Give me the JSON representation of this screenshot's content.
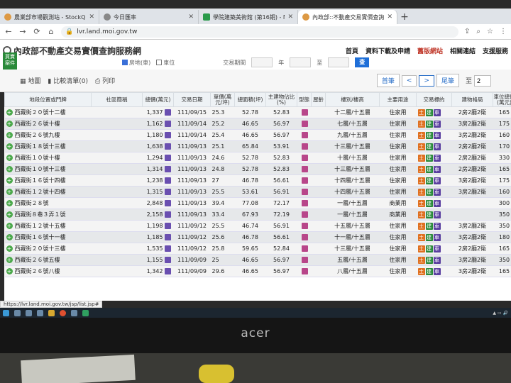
{
  "browser": {
    "tabs": [
      {
        "title": "農業部市場觀測站 - StockQ.org",
        "active": false
      },
      {
        "title": "今日匯率",
        "active": false
      },
      {
        "title": "學院建築美術館 (第16期) - Mobi",
        "active": false
      },
      {
        "title": "內政部::不動產交易實價查詢服務網",
        "active": true
      }
    ],
    "url": "lvr.land.moi.gov.tw",
    "newtab": "+"
  },
  "site": {
    "logo": "內政部不動產交易實價查詢服務網",
    "nav": [
      "首頁",
      "資料下載及申請",
      "舊版網站",
      "相關連結",
      "支援服務"
    ],
    "side_tab": "買賣案件",
    "filters": {
      "house": "房地(車)",
      "land": "車位",
      "period_label": "交易期間",
      "year": "年",
      "to": "至",
      "btn": "查"
    },
    "actions": [
      "地圖",
      "比較清單(0)",
      "列印"
    ],
    "pager": {
      "first": "首筆",
      "prev": "<",
      "next": ">",
      "last": "尾筆",
      "goto": "至",
      "page": "2"
    }
  },
  "table": {
    "headers": [
      "地段位置或門牌",
      "社區簡稱",
      "總價(萬元)",
      "交易日期",
      "單價(萬元/坪)",
      "總面積(坪)",
      "主建物佔比(%)",
      "型態",
      "屋齡",
      "樓別/樓高",
      "主要用途",
      "交易標的",
      "建物格局",
      "車位總價(萬元)"
    ],
    "rows": [
      {
        "loc": "西藏街２０號十二樓",
        "total": "1,337",
        "date": "111/09/15",
        "unit": "25.3",
        "area": "52.78",
        "ratio": "52.83",
        "floor": "十二層/十五層",
        "use": "住家用",
        "layout": "2房2廳2衛",
        "park": "165"
      },
      {
        "loc": "西藏街２６號十樓",
        "total": "1,162",
        "date": "111/09/14",
        "unit": "25.2",
        "area": "46.65",
        "ratio": "56.97",
        "floor": "七層/十五層",
        "use": "住家用",
        "layout": "3房2廳2衛",
        "park": "175"
      },
      {
        "loc": "西藏街２６號九樓",
        "total": "1,180",
        "date": "111/09/14",
        "unit": "25.4",
        "area": "46.65",
        "ratio": "56.97",
        "floor": "九層/十五層",
        "use": "住家用",
        "layout": "3房2廳2衛",
        "park": "160"
      },
      {
        "loc": "西藏街１８號十三樓",
        "total": "1,638",
        "date": "111/09/13",
        "unit": "25.1",
        "area": "65.84",
        "ratio": "53.91",
        "floor": "十三層/十五層",
        "use": "住家用",
        "layout": "2房2廳2衛",
        "park": "170"
      },
      {
        "loc": "西藏街１０號十樓",
        "total": "1,294",
        "date": "111/09/13",
        "unit": "24.6",
        "area": "52.78",
        "ratio": "52.83",
        "floor": "十層/十五層",
        "use": "住家用",
        "layout": "2房2廳2衛",
        "park": "330"
      },
      {
        "loc": "西藏街１０號十三樓",
        "total": "1,314",
        "date": "111/09/13",
        "unit": "24.8",
        "area": "52.78",
        "ratio": "52.83",
        "floor": "十三層/十五層",
        "use": "住家用",
        "layout": "2房2廳2衛",
        "park": "165"
      },
      {
        "loc": "西藏街１６號十四樓",
        "total": "1,238",
        "date": "111/09/13",
        "unit": "27",
        "area": "46.78",
        "ratio": "56.61",
        "floor": "十四層/十五層",
        "use": "住家用",
        "layout": "3房2廳2衛",
        "park": "175"
      },
      {
        "loc": "西藏街１２號十四樓",
        "total": "1,315",
        "date": "111/09/13",
        "unit": "25.5",
        "area": "53.61",
        "ratio": "56.91",
        "floor": "十四層/十五層",
        "use": "住家用",
        "layout": "3房2廳2衛",
        "park": "160"
      },
      {
        "loc": "西藏街２８號",
        "total": "2,848",
        "date": "111/09/13",
        "unit": "39.4",
        "area": "77.08",
        "ratio": "72.17",
        "floor": "一層/十五層",
        "use": "商業用",
        "layout": "",
        "park": "300"
      },
      {
        "loc": "西藏街８巷３弄１號",
        "total": "2,158",
        "date": "111/09/13",
        "unit": "33.4",
        "area": "67.93",
        "ratio": "72.19",
        "floor": "一層/十五層",
        "use": "商業用",
        "layout": "",
        "park": "350"
      },
      {
        "loc": "西藏街１２號十五樓",
        "total": "1,198",
        "date": "111/09/12",
        "unit": "25.5",
        "area": "46.74",
        "ratio": "56.91",
        "floor": "十五層/十五層",
        "use": "住家用",
        "layout": "3房2廳2衛",
        "park": "350"
      },
      {
        "loc": "西藏街１６號十一樓",
        "total": "1,185",
        "date": "111/09/12",
        "unit": "25.6",
        "area": "46.78",
        "ratio": "56.61",
        "floor": "十一層/十五層",
        "use": "住家用",
        "layout": "3房2廳2衛",
        "park": "180"
      },
      {
        "loc": "西藏街２０號十三樓",
        "total": "1,535",
        "date": "111/09/12",
        "unit": "25.8",
        "area": "59.65",
        "ratio": "52.84",
        "floor": "十三層/十五層",
        "use": "住家用",
        "layout": "2房2廳2衛",
        "park": "165"
      },
      {
        "loc": "西藏街２６號五樓",
        "total": "1,155",
        "date": "111/09/09",
        "unit": "25",
        "area": "46.65",
        "ratio": "56.97",
        "floor": "五層/十五層",
        "use": "住家用",
        "layout": "3房2廳2衛",
        "park": "350"
      },
      {
        "loc": "西藏街２６號八樓",
        "total": "1,342",
        "date": "111/09/09",
        "unit": "29.6",
        "area": "46.65",
        "ratio": "56.97",
        "floor": "八層/十五層",
        "use": "住家用",
        "layout": "3房2廳2衛",
        "park": "165"
      }
    ]
  },
  "status_url": "https://lvr.land.moi.gov.tw/jsp/list.jsp#",
  "monitor_brand": "acer"
}
